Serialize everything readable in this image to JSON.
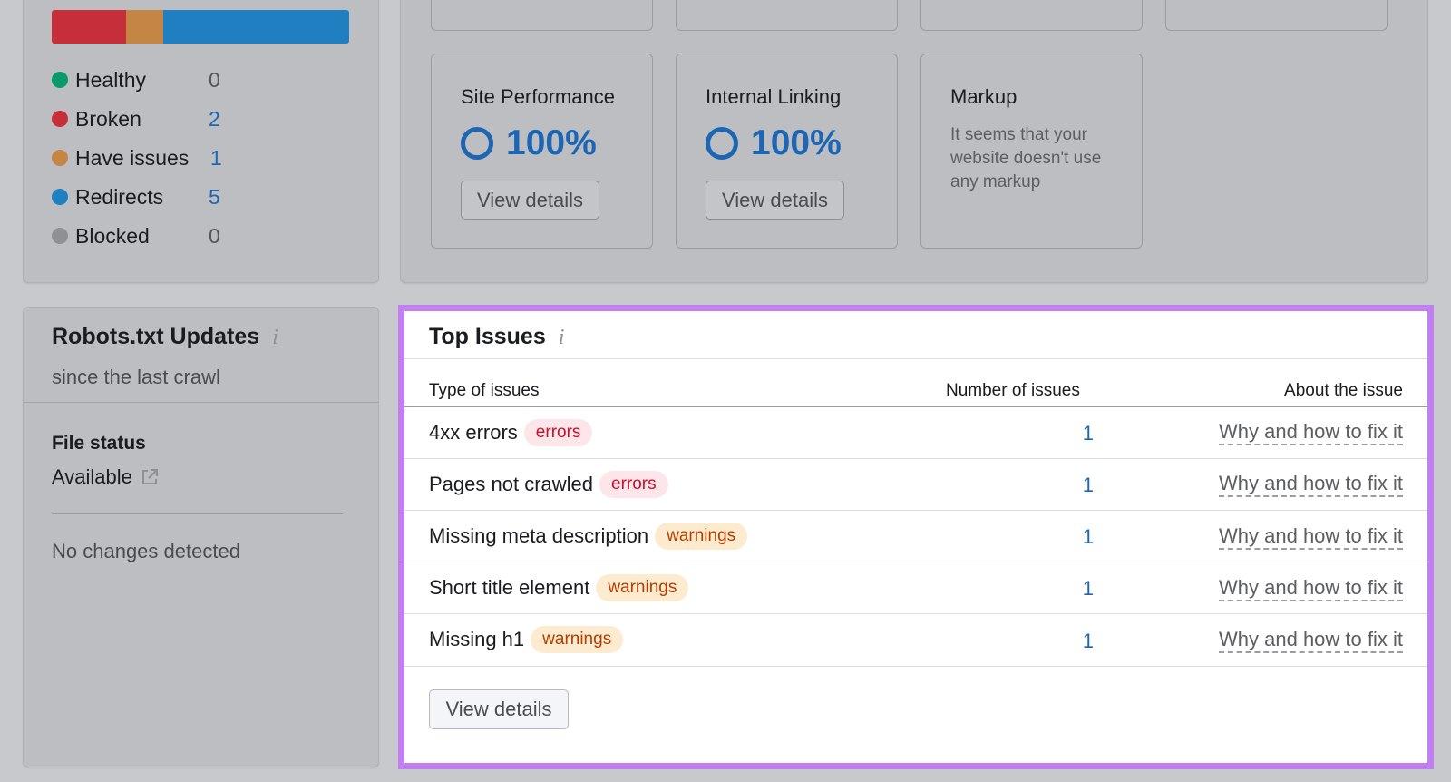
{
  "status": {
    "segments": [
      {
        "name": "broken",
        "color": "#c62f3a",
        "fraction": 0.25
      },
      {
        "name": "have-issues",
        "color": "#c58545",
        "fraction": 0.125
      },
      {
        "name": "redirects",
        "color": "#1f7fc1",
        "fraction": 0.625
      }
    ],
    "rows": [
      {
        "label": "Healthy",
        "count": "0",
        "color": "#0a9a6a",
        "count_color": "#54565a"
      },
      {
        "label": "Broken",
        "count": "2",
        "color": "#c62f3a",
        "count_color": "#1d66b3"
      },
      {
        "label": "Have issues",
        "count": "1",
        "color": "#c58545",
        "count_color": "#1d66b3"
      },
      {
        "label": "Redirects",
        "count": "5",
        "color": "#1f7fc1",
        "count_color": "#1d66b3"
      },
      {
        "label": "Blocked",
        "count": "0",
        "color": "#8f9094",
        "count_color": "#54565a"
      }
    ]
  },
  "thematic": {
    "site_performance": {
      "title": "Site Performance",
      "value": "100%",
      "button": "View details"
    },
    "internal_linking": {
      "title": "Internal Linking",
      "value": "100%",
      "button": "View details"
    },
    "markup": {
      "title": "Markup",
      "description": "It seems that your website doesn't use any markup"
    }
  },
  "robots": {
    "title": "Robots.txt Updates",
    "info_icon": "i",
    "subtitle": "since the last crawl",
    "file_status_label": "File status",
    "file_status_value": "Available",
    "no_changes": "No changes detected"
  },
  "top_issues": {
    "title": "Top Issues",
    "info_icon": "i",
    "columns": {
      "type": "Type of issues",
      "number": "Number of issues",
      "about": "About the issue"
    },
    "rows": [
      {
        "name": "4xx errors",
        "badge": "errors",
        "severity": "err",
        "count": "1",
        "link": "Why and how to fix it"
      },
      {
        "name": "Pages not crawled",
        "badge": "errors",
        "severity": "err",
        "count": "1",
        "link": "Why and how to fix it"
      },
      {
        "name": "Missing meta description",
        "badge": "warnings",
        "severity": "warn",
        "count": "1",
        "link": "Why and how to fix it"
      },
      {
        "name": "Short title element",
        "badge": "warnings",
        "severity": "warn",
        "count": "1",
        "link": "Why and how to fix it"
      },
      {
        "name": "Missing h1",
        "badge": "warnings",
        "severity": "warn",
        "count": "1",
        "link": "Why and how to fix it"
      }
    ],
    "button": "View details"
  }
}
